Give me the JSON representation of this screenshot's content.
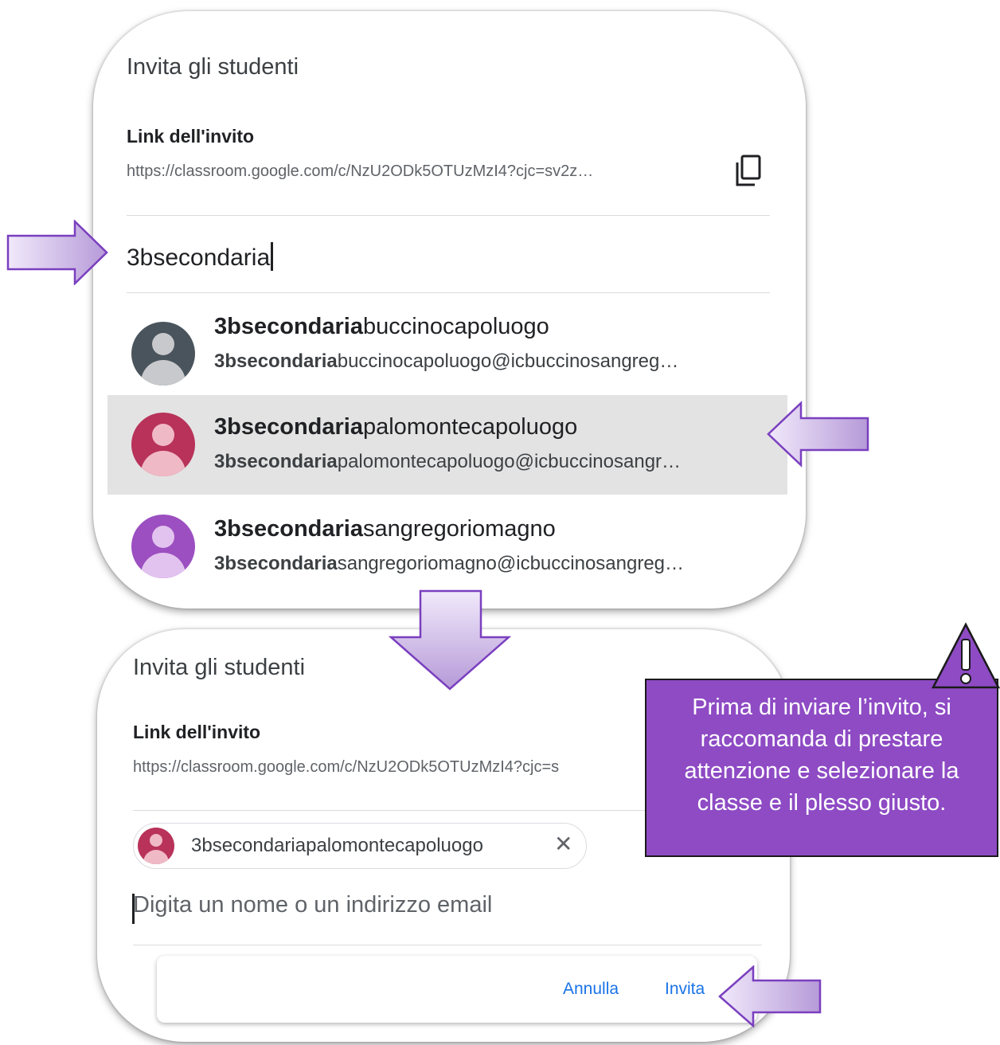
{
  "top_dialog": {
    "title": "Invita gli studenti",
    "link_label": "Link dell'invito",
    "link_url": "https://classroom.google.com/c/NzU2ODk5OTUzMzI4?cjc=sv2z…",
    "search_value": "3bsecondaria",
    "results": [
      {
        "name_bold": "3bsecondaria",
        "name_rest": "buccinocapoluogo",
        "email_bold": "3bsecondaria",
        "email_rest": "buccinocapoluogo@icbuccinosangreg…",
        "avatar_color": "#4a545c",
        "avatar_figure_color": "#c7c9cc"
      },
      {
        "name_bold": "3bsecondaria",
        "name_rest": "palomontecapoluogo",
        "email_bold": "3bsecondaria",
        "email_rest": "palomontecapoluogo@icbuccinosangr…",
        "avatar_color": "#b8325a",
        "avatar_figure_color": "#f0b9c6",
        "selected": true
      },
      {
        "name_bold": "3bsecondaria",
        "name_rest": "sangregoriomagno",
        "email_bold": "3bsecondaria",
        "email_rest": "sangregoriomagno@icbuccinosangreg…",
        "avatar_color": "#9c4fc0",
        "avatar_figure_color": "#e2c3ef"
      }
    ]
  },
  "bottom_dialog": {
    "title": "Invita gli studenti",
    "link_label": "Link dell'invito",
    "link_url": "https://classroom.google.com/c/NzU2ODk5OTUzMzI4?cjc=s",
    "chip_label": "3bsecondariapalomontecapoluogo",
    "chip_remove": "✕",
    "input_placeholder": "Digita un nome o un indirizzo email",
    "cancel_label": "Annulla",
    "invite_label": "Invita"
  },
  "warning": {
    "text": "Prima di inviare l’invito, si raccomanda di prestare attenzione e selezionare la classe e il plesso giusto."
  },
  "colors": {
    "arrow_fill_top": "#f1e9fb",
    "arrow_fill_bottom": "#b69ad8",
    "arrow_stroke": "#7a3fbf",
    "warning_bg": "#8e4bc4",
    "link_blue": "#1a73e8",
    "selected_row": "#e3e3e3"
  },
  "icons": {
    "copy": "copy-icon",
    "warning": "warning-triangle-icon",
    "arrows": "callout-arrow"
  }
}
